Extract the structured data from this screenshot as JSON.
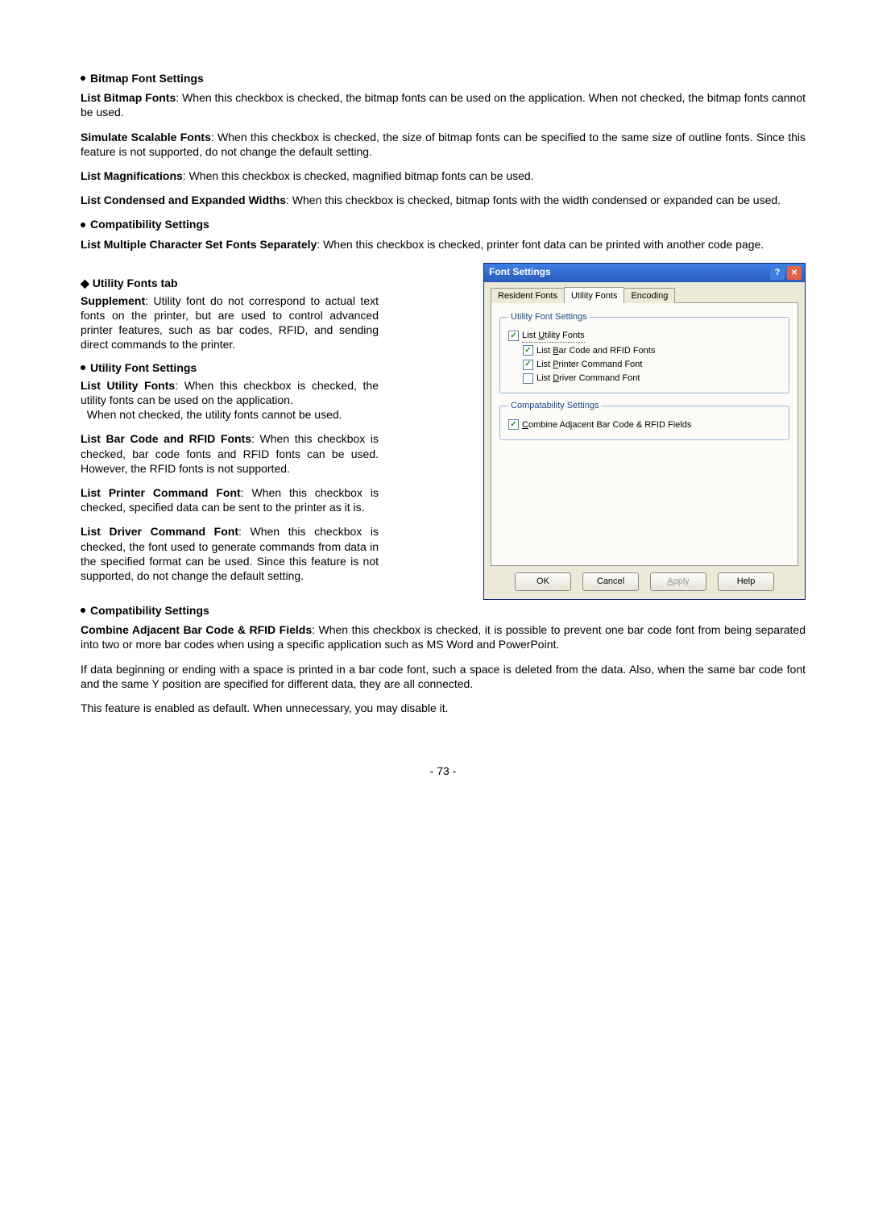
{
  "section_bitmap": {
    "heading": "Bitmap Font Settings",
    "list_bitmap_label": "List Bitmap Fonts",
    "list_bitmap_text": ":   When this checkbox is checked, the bitmap fonts can be used on the application. When not checked, the bitmap fonts cannot be used.",
    "simulate_label": "Simulate Scalable Fonts",
    "simulate_text": ":   When this checkbox is checked, the size of bitmap fonts can be specified to the same size of outline fonts.   Since this feature is not supported, do not change the default setting.",
    "list_mag_label": "List Magnifications",
    "list_mag_text": ":   When this checkbox is checked, magnified bitmap fonts can be used.",
    "list_cond_label": "List Condensed and Expanded Widths",
    "list_cond_text": ": When this checkbox is checked, bitmap fonts with the width condensed or expanded can be used."
  },
  "section_compat1": {
    "heading": "Compatibility Settings",
    "lm_label": "List Multiple Character Set Fonts Separately",
    "lm_text": ":  When this checkbox is checked, printer font data can be printed with another code page."
  },
  "utility_tab": {
    "heading": "Utility Fonts tab",
    "supplement_label": "Supplement",
    "supplement_text": ": Utility font do not correspond to actual text fonts on the printer, but are used to control advanced printer features, such as bar codes, RFID, and sending direct commands to the printer.",
    "ufs_heading": "Utility Font Settings",
    "luf_label": "List Utility Fonts",
    "luf_text": ":  When this checkbox is checked, the utility fonts can be used on the application.",
    "luf_text2": "When not checked, the utility fonts cannot be used.",
    "lbr_label": "List Bar Code and RFID Fonts",
    "lbr_text": ":   When this checkbox is checked, bar code fonts and RFID fonts can be used.   However, the RFID fonts is not supported.",
    "lpc_label": "List Printer Command Font",
    "lpc_text": ":    When this checkbox is checked, specified data can be sent to the printer as it is.",
    "ldc_label": "List Driver Command Font",
    "ldc_text": ":    When this checkbox is checked, the font used to generate commands from data in the specified format can be used.   Since this feature is not supported, do not change the default setting."
  },
  "section_compat2": {
    "heading": "Compatibility Settings",
    "cab_label": "Combine Adjacent Bar Code & RFID Fields",
    "cab_text": ":  When this checkbox is checked, it is possible to prevent one bar code font from being separated into two or more bar codes when using a specific application such as MS Word and PowerPoint.",
    "cab_extra1": "If data beginning or ending with a space is printed in a bar code font, such a space is deleted from the data. Also, when the same bar code font and the same Y position are specified for different data, they are all connected.",
    "cab_extra2": "This feature is enabled as default.   When unnecessary, you may disable it."
  },
  "dialog": {
    "title": "Font Settings",
    "tabs": {
      "resident": "Resident Fonts",
      "utility": "Utility Fonts",
      "encoding": "Encoding"
    },
    "group1": {
      "legend": "Utility Font Settings",
      "chk_list_utility_pre": "List ",
      "chk_list_utility_u": "U",
      "chk_list_utility_post": "tility Fonts",
      "chk_bar_pre": "List ",
      "chk_bar_u": "B",
      "chk_bar_post": "ar Code and RFID Fonts",
      "chk_printer_pre": "List ",
      "chk_printer_u": "P",
      "chk_printer_post": "rinter Command Font",
      "chk_driver_pre": "List ",
      "chk_driver_u": "D",
      "chk_driver_post": "river Command Font"
    },
    "group2": {
      "legend": "Compatability Settings",
      "chk_combine_u": "C",
      "chk_combine_post": "ombine Adjacent Bar Code & RFID Fields"
    },
    "buttons": {
      "ok": "OK",
      "cancel": "Cancel",
      "apply_u": "A",
      "apply_post": "pply",
      "help": "Help"
    }
  },
  "page_number": "- 73 -",
  "chk_states": {
    "list_utility": true,
    "list_bar": true,
    "list_printer": true,
    "list_driver": false,
    "combine": true
  }
}
